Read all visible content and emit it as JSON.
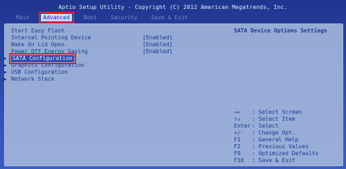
{
  "titlebar": {
    "text": "Aptio Setup Utility - Copyright (C) 2012 American Megatrends, Inc."
  },
  "menubar": {
    "items": [
      "Main",
      "Advanced",
      "Boot",
      "Security",
      "Save & Exit"
    ],
    "active": "Advanced"
  },
  "settings": [
    {
      "label": "Start Easy Flash",
      "value": ""
    },
    {
      "label": "Internal Pointing Device",
      "value": "[Enabled]"
    },
    {
      "label": "Wake On Lid Open",
      "value": "[Enabled]"
    },
    {
      "label": "Power Off Energy Saving",
      "value": "[Enabled]"
    },
    {
      "label": "SATA Configuration",
      "value": "",
      "submenu": true,
      "selected": true
    },
    {
      "label": "Graphics Configuration",
      "value": "",
      "submenu": true
    },
    {
      "label": "USB Configuration",
      "value": "",
      "submenu": true
    },
    {
      "label": "Network Stack",
      "value": "",
      "submenu": true
    }
  ],
  "help": {
    "title": "SATA Device Options Settings",
    "keys": [
      {
        "key": "→←",
        "desc": ": Select Screen"
      },
      {
        "key": "↑↓",
        "desc": ": Select Item"
      },
      {
        "key": "Enter",
        "desc": ": Select"
      },
      {
        "key": "+/-",
        "desc": ": Change Opt."
      },
      {
        "key": "F1",
        "desc": ": General Help"
      },
      {
        "key": "F2",
        "desc": ": Previous Values"
      },
      {
        "key": "F9",
        "desc": ": Optimized Defaults"
      },
      {
        "key": "F10",
        "desc": ": Save & Exit"
      }
    ]
  },
  "colors": {
    "background": "#2a46a6",
    "panel": "#a5b9dc",
    "selection": "#2c4bb0",
    "highlight_box": "#e0262a"
  }
}
